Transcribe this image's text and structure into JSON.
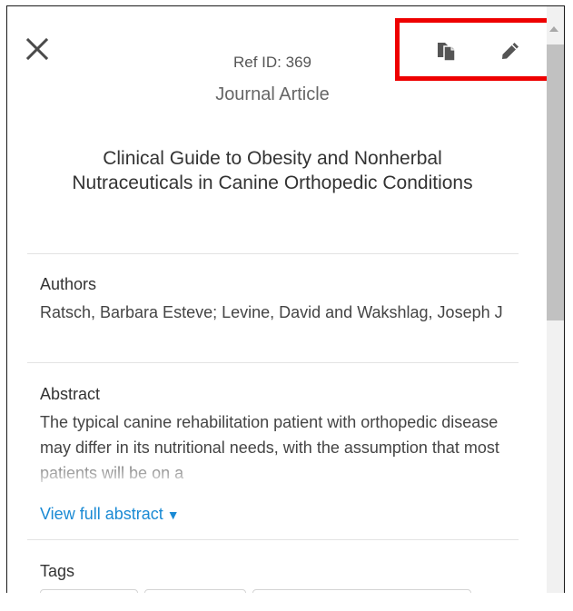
{
  "header": {
    "ref_id": "Ref ID: 369",
    "ref_type": "Journal Article",
    "title": "Clinical Guide to Obesity and Nonherbal Nutraceuticals in Canine Orthopedic Conditions"
  },
  "toolbar": {
    "close_icon": "close-icon",
    "copy_icon": "copy-icon",
    "edit_icon": "pencil-icon",
    "highlight_color": "#ee0000"
  },
  "authors": {
    "label": "Authors",
    "value": "Ratsch, Barbara Esteve; Levine, David and Wakshlag, Joseph J"
  },
  "abstract": {
    "label": "Abstract",
    "text": "The typical canine rehabilitation patient with orthopedic disease may differ in its nutritional needs, with the assumption that most patients will be on a",
    "view_full_label": "View full abstract",
    "caret": "▼",
    "link_color": "#1a8ad4"
  },
  "tags": {
    "label": "Tags"
  }
}
